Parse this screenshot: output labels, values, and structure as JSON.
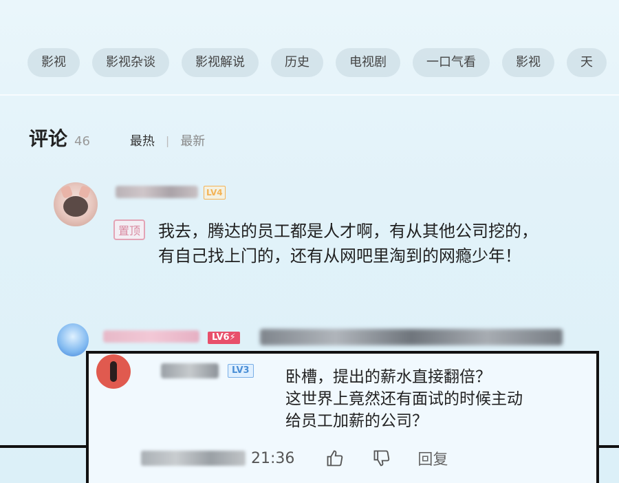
{
  "tags": [
    "影视",
    "影视杂谈",
    "影视解说",
    "历史",
    "电视剧",
    "一口气看",
    "影视",
    "天"
  ],
  "comments_header": {
    "title": "评论",
    "count": "46",
    "sort_hot": "最热",
    "sort_new": "最新"
  },
  "comment1": {
    "level": "LV4",
    "pinned_label": "置顶",
    "text_line1": "我去，腾达的员工都是人才啊，有从其他公司挖的，",
    "text_line2": "有自己找上门的，还有从网吧里淘到的网瘾少年！"
  },
  "comment2": {
    "level": "LV6⚡"
  },
  "comment3": {
    "level": "LV3",
    "text_line1": "卧槽，提出的薪水直接翻倍？",
    "text_line2": "这世界上竟然还有面试的时候主动",
    "text_line3": "给员工加薪的公司？",
    "time": "21:36",
    "reply_label": "回复",
    "like_icon": "thumbs-up-icon",
    "dislike_icon": "thumbs-down-icon"
  },
  "colors": {
    "pin": "#e3a3b5",
    "lv4": "#f3b356",
    "lv6": "#e8506b",
    "lv3": "#78aee6"
  }
}
